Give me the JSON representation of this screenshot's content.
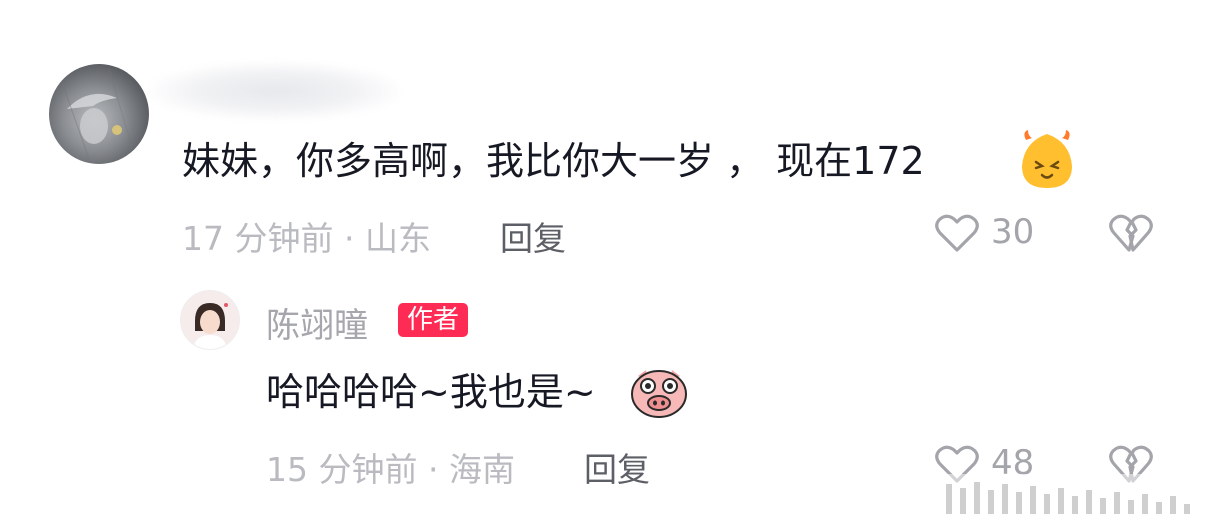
{
  "comment": {
    "text": "妹妹，你多高啊，我比你大一岁 ， 现在172",
    "emoji_icon": "smiling-fire-face-icon",
    "meta": "17 分钟前 · 山东",
    "reply_label": "回复",
    "like_count": "30"
  },
  "reply": {
    "author_name": "陈翊曈",
    "author_badge": "作者",
    "text": "哈哈哈哈~我也是~",
    "emoji_icon": "pig-face-icon",
    "meta": "15 分钟前 · 海南",
    "reply_label": "回复",
    "like_count": "48"
  },
  "colors": {
    "badge": "#fe2c55",
    "meta_text": "#b9bbc0",
    "reply_text": "#5d5f66",
    "icon_stroke": "#a3a5aa"
  }
}
